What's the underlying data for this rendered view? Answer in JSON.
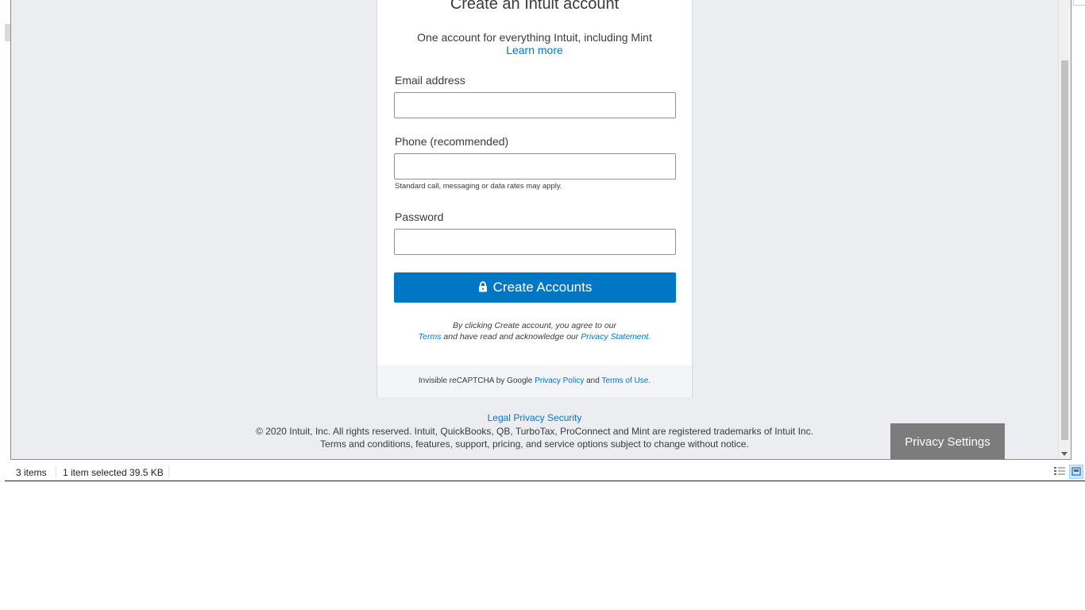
{
  "card": {
    "title": "Create an Intuit account",
    "subtitle": "One account for everything Intuit, including Mint",
    "learn_more": "Learn more",
    "email_label": "Email address",
    "email_value": "",
    "phone_label": "Phone (recommended)",
    "phone_value": "",
    "phone_hint": "Standard call, messaging or data rates may apply.",
    "password_label": "Password",
    "password_value": "",
    "create_button": "Create Accounts",
    "legal_prefix": "By clicking Create account, you agree to our",
    "terms_link": "Terms",
    "legal_middle": "and have read and acknowledge our",
    "privacy_link": "Privacy Statement",
    "legal_suffix": ".",
    "recaptcha_prefix": "Invisible reCAPTCHA by Google",
    "recaptcha_privacy": "Privacy Policy",
    "recaptcha_and": "and",
    "recaptcha_terms": "Terms of Use."
  },
  "footer": {
    "legal": "Legal",
    "privacy": "Privacy",
    "security": "Security",
    "copyright": "© 2020 Intuit, Inc. All rights reserved. Intuit, QuickBooks, QB, TurboTax, ProConnect and Mint are registered trademarks of Intuit Inc.",
    "terms_notice": "Terms and conditions, features, support, pricing, and service options subject to change without notice."
  },
  "privacy_settings": "Privacy Settings",
  "status_bar": {
    "item_count": "3 items",
    "selection": "1 item selected  39.5 KB"
  },
  "colors": {
    "accent": "#0077c5",
    "page_background": "#ecedf0",
    "privacy_button": "#7c7c7c"
  }
}
